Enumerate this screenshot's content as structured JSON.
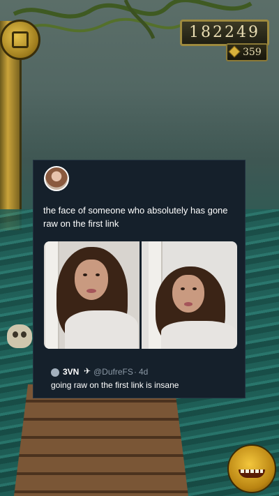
{
  "game": {
    "score": "182249",
    "coins": "359",
    "icons": [
      "idol-icon",
      "coin-gem-icon",
      "monkey-icon",
      "skull-icon"
    ],
    "accent": "#9e8a3e"
  },
  "tweet": {
    "text": "the face of someone who absolutely has gone raw on the first link",
    "background": "#15202b",
    "quoted": {
      "name": "3VN",
      "badge_icon": "twitter-bird-icon",
      "handle": "@DufreFS",
      "separator": "·",
      "age": "4d",
      "text": "going raw on the first link is insane"
    }
  }
}
